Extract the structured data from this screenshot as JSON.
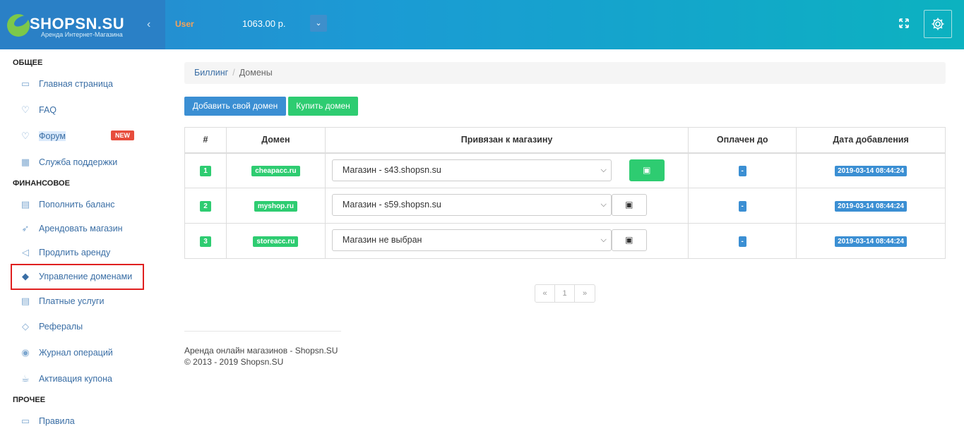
{
  "header": {
    "logo_text": "SHOPSN.SU",
    "logo_sub": "Аренда Интернет-Магазина",
    "collapse_icon": "‹",
    "user": "User",
    "balance": "1063.00 р.",
    "dropdown_icon": "⌄"
  },
  "sidebar": {
    "section_general": "ОБЩЕЕ",
    "section_finance": "ФИНАНСОВОЕ",
    "section_other": "ПРОЧЕЕ",
    "items": [
      {
        "label": "Главная страница",
        "icon": "monitor-icon"
      },
      {
        "label": "FAQ",
        "icon": "bulb-icon"
      },
      {
        "label": "Форум",
        "icon": "bulb-icon",
        "badge": "NEW"
      },
      {
        "label": "Служба поддержки",
        "icon": "calculator-icon"
      },
      {
        "label": "Пополнить баланс",
        "icon": "wallet-icon"
      },
      {
        "label": "Арендовать магазин",
        "icon": "rocket-icon"
      },
      {
        "label": "Продлить аренду",
        "icon": "paper-plane-icon"
      },
      {
        "label": "Управление доменами",
        "icon": "tags-icon"
      },
      {
        "label": "Платные услуги",
        "icon": "wallet-icon"
      },
      {
        "label": "Рефералы",
        "icon": "diamond-icon"
      },
      {
        "label": "Журнал операций",
        "icon": "eye-icon"
      },
      {
        "label": "Активация купона",
        "icon": "cup-icon"
      },
      {
        "label": "Правила",
        "icon": "monitor-icon"
      }
    ]
  },
  "breadcrumb": {
    "parent": "Биллинг",
    "separator": "/",
    "current": "Домены"
  },
  "buttons": {
    "add_domain": "Добавить свой домен",
    "buy_domain": "Купить домен"
  },
  "table": {
    "headers": [
      "#",
      "Домен",
      "Привязан к магазину",
      "Оплачен до",
      "Дата добавления"
    ],
    "rows": [
      {
        "num": "1",
        "domain": "cheapacc.ru",
        "store": "Магазин - s43.shopsn.su",
        "paid_until": "-",
        "added": "2019-03-14 08:44:24"
      },
      {
        "num": "2",
        "domain": "myshop.ru",
        "store": "Магазин - s59.shopsn.su",
        "paid_until": "-",
        "added": "2019-03-14 08:44:24"
      },
      {
        "num": "3",
        "domain": "storeacc.ru",
        "store": "Магазин не выбран",
        "paid_until": "-",
        "added": "2019-03-14 08:44:24"
      }
    ]
  },
  "pagination": {
    "prev": "«",
    "page": "1",
    "next": "»"
  },
  "footer": {
    "line1": "Аренда онлайн магазинов - Shopsn.SU",
    "line2": "© 2013 - 2019 Shopsn.SU"
  },
  "colors": {
    "header_start": "#2a87cf",
    "header_end": "#0cb2c0",
    "accent_blue": "#3b8fd3",
    "accent_green": "#2ecc71",
    "badge_red": "#e74c3c",
    "highlight_red": "#e02020"
  }
}
